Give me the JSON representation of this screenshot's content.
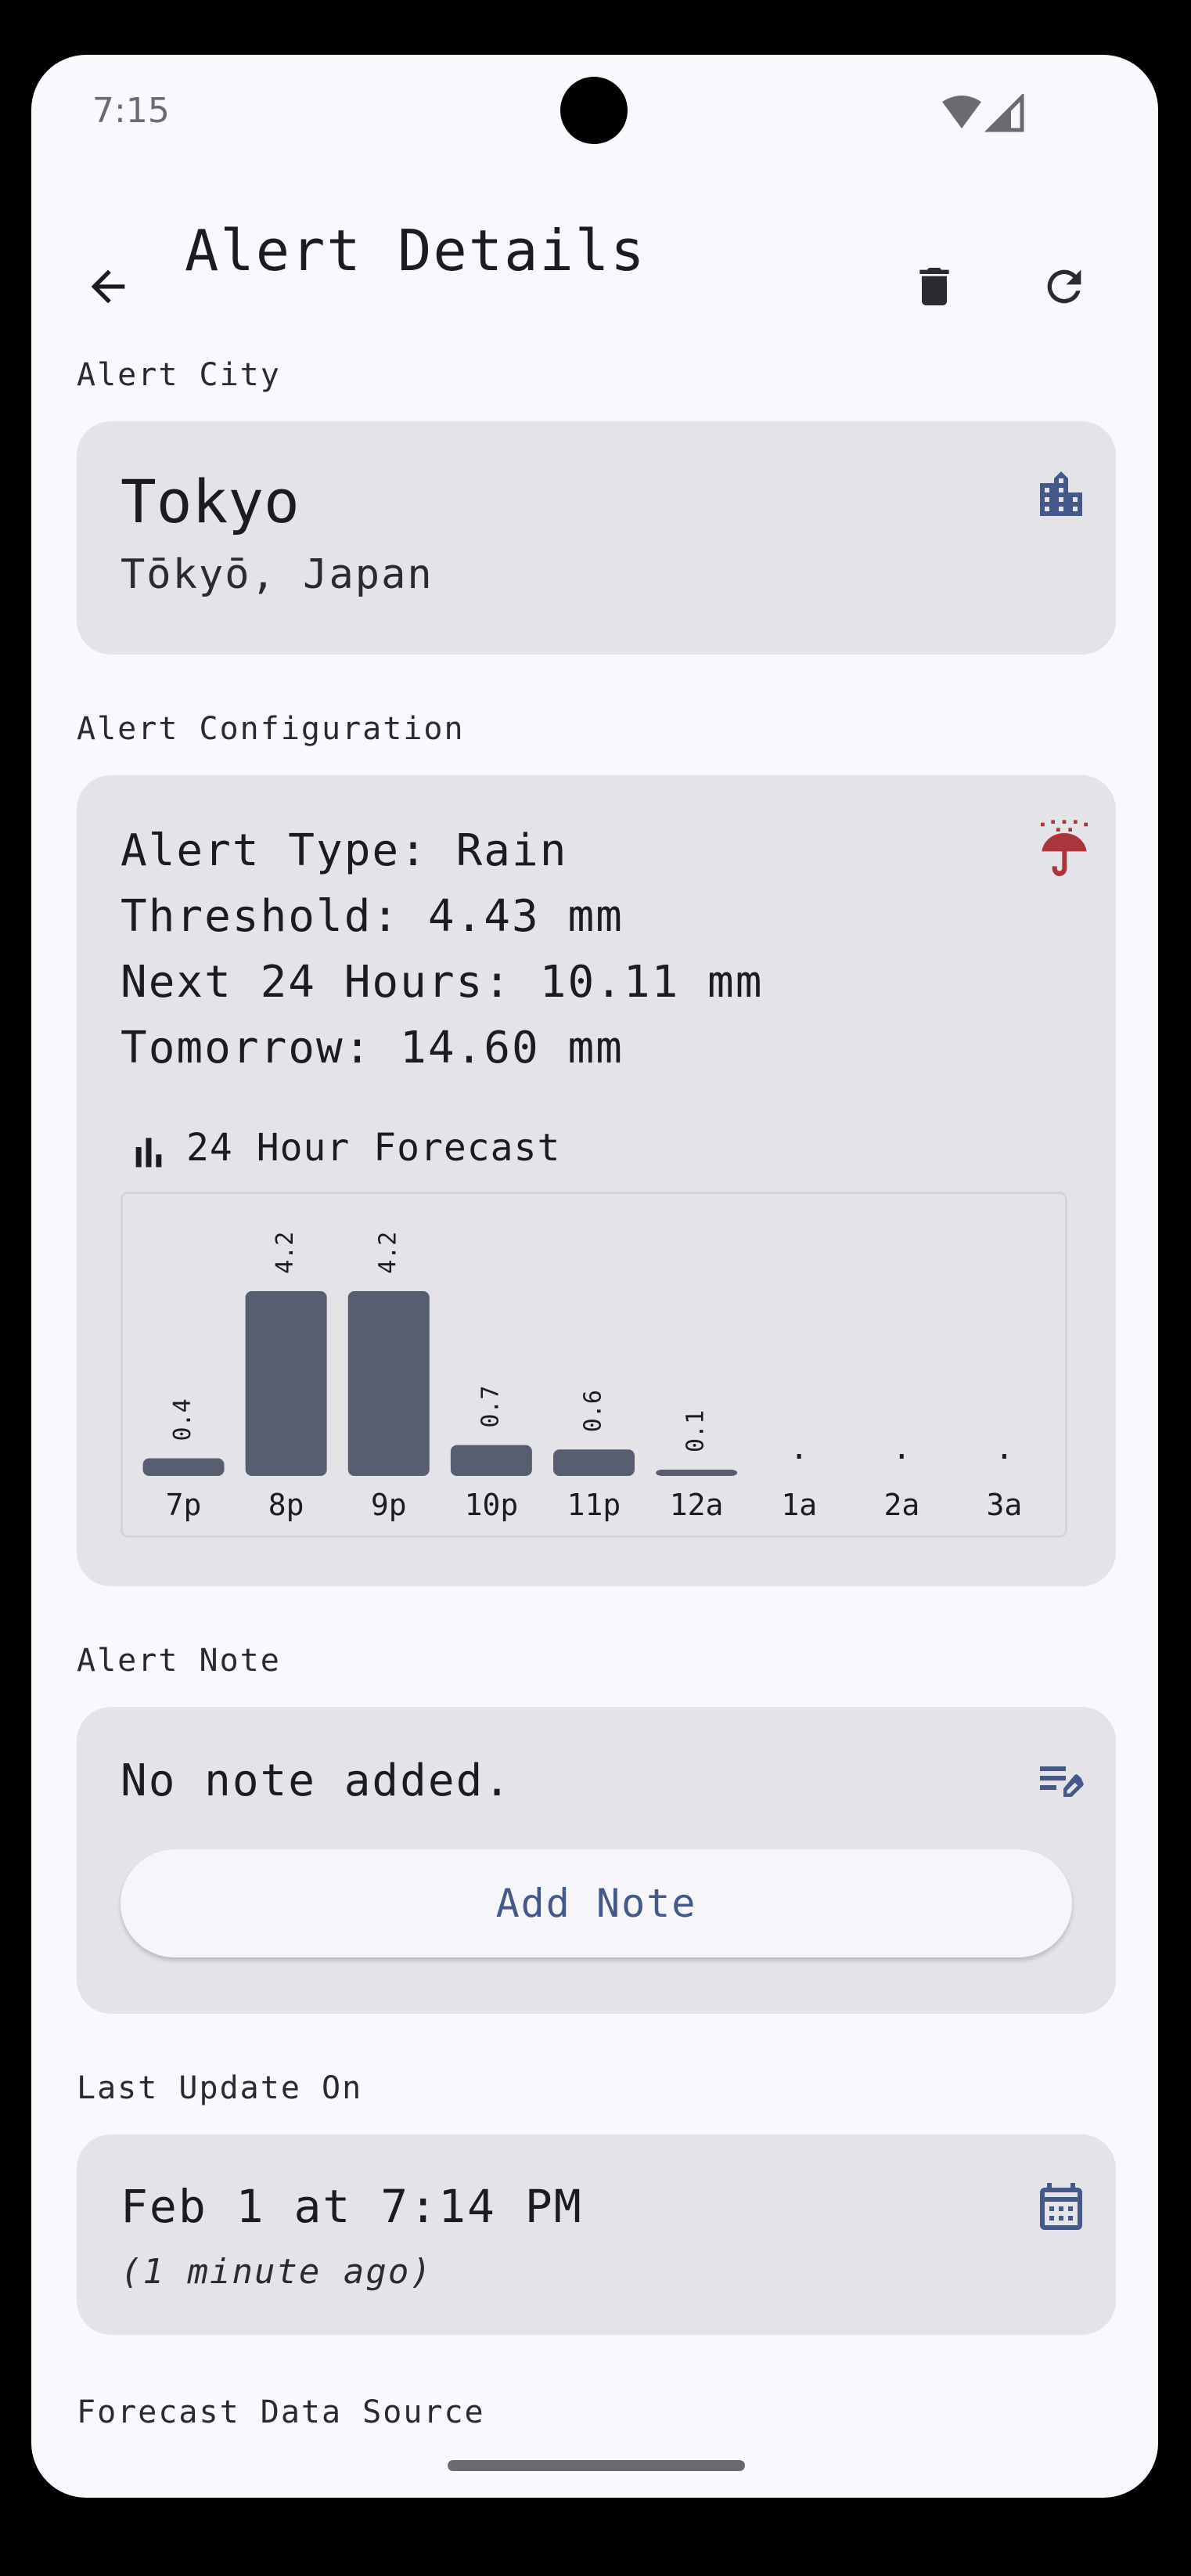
{
  "status_bar": {
    "time": "7:15"
  },
  "app_bar": {
    "title": "Alert Details",
    "back_icon": "arrow-back-icon",
    "delete_icon": "trash-icon",
    "refresh_icon": "refresh-icon"
  },
  "city": {
    "section_label": "Alert City",
    "name": "Tokyo",
    "region": "Tōkyō, Japan",
    "icon": "building-icon"
  },
  "configuration": {
    "section_label": "Alert Configuration",
    "alert_type": "Alert Type: Rain",
    "threshold": "Threshold: 4.43 mm",
    "next_24": "Next 24 Hours: 10.11 mm",
    "tomorrow": "Tomorrow: 14.60 mm",
    "icon": "umbrella-rain-icon",
    "forecast_title": "24 Hour Forecast",
    "forecast_icon": "bar-chart-icon"
  },
  "chart_data": {
    "type": "bar",
    "categories": [
      "7p",
      "8p",
      "9p",
      "10p",
      "11p",
      "12a",
      "1a",
      "2a",
      "3a"
    ],
    "values": [
      0.4,
      4.2,
      4.2,
      0.7,
      0.6,
      0.1,
      0,
      0,
      0
    ],
    "value_labels": [
      "0.4",
      "4.2",
      "4.2",
      "0.7",
      "0.6",
      "0.1",
      ".",
      ".",
      "."
    ],
    "title": "24 Hour Forecast",
    "xlabel": "",
    "ylabel": "",
    "ylim": [
      0,
      4.2
    ],
    "bar_color": "#575e71"
  },
  "note": {
    "section_label": "Alert Note",
    "text": "No note added.",
    "button_label": "Add Note",
    "icon": "edit-note-icon"
  },
  "last_update": {
    "section_label": "Last Update On",
    "date": "Feb 1 at 7:14 PM",
    "relative": "(1 minute ago)",
    "icon": "calendar-icon"
  },
  "data_source": {
    "section_label": "Forecast Data Source"
  },
  "colors": {
    "accent_blue": "#44588a",
    "rain_red": "#a8363a",
    "card_bg": "#e4e3e8",
    "screen_bg": "#f9f8fd"
  }
}
